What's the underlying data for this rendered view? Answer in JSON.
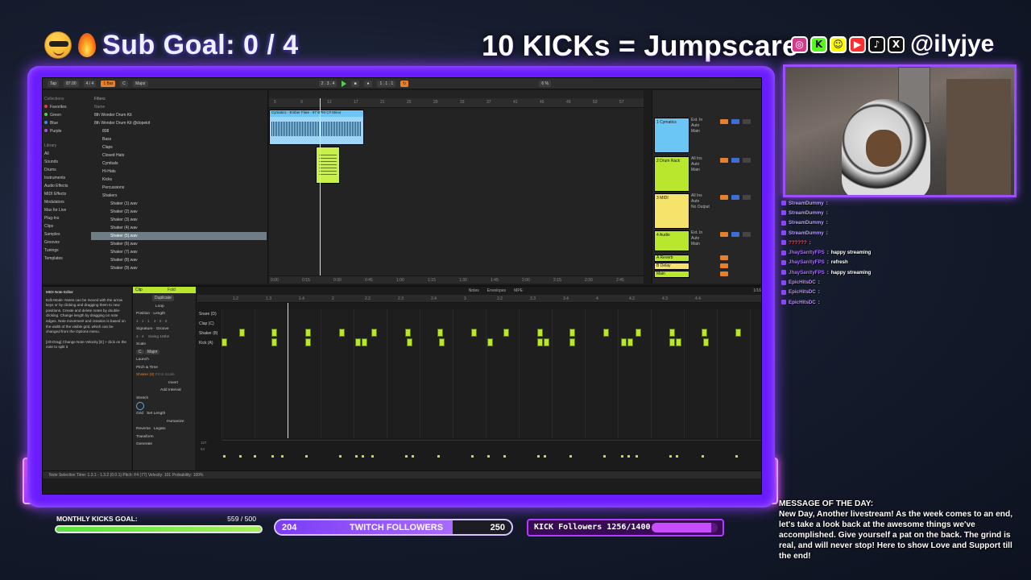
{
  "overlay": {
    "sub_goal": "Sub Goal: 0 / 4",
    "jumpscare": "10 KICKs = Jumpscare",
    "handle": "@ilyjye",
    "social_icons": [
      "instagram-icon",
      "kick-icon",
      "snapchat-icon",
      "youtube-icon",
      "tiktok-icon",
      "x-icon"
    ]
  },
  "daw": {
    "topbar": {
      "tempo": "Tap",
      "bpm": "87.00",
      "meter": "4 / 4",
      "quantize": "1 Bar",
      "key": "C",
      "scale": "Major",
      "position": "2 . 3 . 4",
      "loop": "1 . 1 . 1",
      "cpu": "6 %"
    },
    "browser": {
      "collections_header": "Collections",
      "collections": [
        "Favorites",
        "Green",
        "Blue",
        "Purple"
      ],
      "library_header": "Library",
      "library": [
        "All",
        "Sounds",
        "Drums",
        "Instruments",
        "Audio Effects",
        "MIDI Effects",
        "Modulators",
        "Max for Live",
        "Plug-Ins",
        "Clips",
        "Samples",
        "Grooves",
        "Tunings",
        "Templates"
      ],
      "filter_label": "Filters",
      "name_header": "Name",
      "tree": [
        "8th Wonder Drum Kit",
        "8th Wonder Drum Kit @dopekit",
        "808",
        "Bass",
        "Claps",
        "Closed Hats",
        "Cymbals",
        "Hi-Hats",
        "Kicks",
        "Percussions",
        "Shakers",
        "Shaker (1).wav",
        "Shaker (2).wav",
        "Shaker (3).wav",
        "Shaker (4).wav",
        "Shaker (5).wav",
        "Shaker (6).wav",
        "Shaker (7).wav",
        "Shaker (8).wav",
        "Shaker (9).wav"
      ],
      "selected_index": 15
    },
    "arrangement": {
      "ruler": [
        "5",
        "9",
        "13",
        "17",
        "21",
        "25",
        "29",
        "33",
        "37",
        "41",
        "45",
        "49",
        "53",
        "57"
      ],
      "audio_clip_name": "Cymatics - Ember Flute - 87 BPM C# Minor",
      "time_ruler": [
        "0:00",
        "0:15",
        "0:30",
        "0:45",
        "1:00",
        "1:15",
        "1:30",
        "1:45",
        "2:00",
        "2:15",
        "2:30",
        "2:45"
      ]
    },
    "mixer": {
      "tracks": [
        {
          "name": "1 Cymatics",
          "color": "#6cc6f5",
          "input": "Ext. In",
          "monitor": "Auto",
          "out": "Main"
        },
        {
          "name": "2 Drum Rack",
          "color": "#b8e72e",
          "input": "All Ins",
          "monitor": "Auto",
          "out": "Main"
        },
        {
          "name": "3 MIDI",
          "color": "#f5e36c",
          "input": "All Ins",
          "monitor": "Auto",
          "out": "No Output"
        },
        {
          "name": "4 Audio",
          "color": "#b8e72e",
          "input": "Ext. In",
          "monitor": "Auto",
          "out": "Main"
        }
      ],
      "returns": [
        "A Reverb",
        "B Delay",
        "Main"
      ],
      "return_colors": [
        "#b8e72e",
        "#f5e36c",
        "#b8e72e"
      ]
    },
    "info_panel": {
      "title": "MIDI Note Editor",
      "body": "Edit Mode: Notes can be moved with the arrow keys or by clicking and dragging them to new positions. Create and delete notes by double-clicking. Change length by dragging on note edges. Note movement and creation is based on the width of the visible grid, which can be changed from the Options menu.",
      "footer": "[Alt-Drag] Change Note Velocity [E] + click on the note to split it"
    },
    "clip_panel": {
      "clip_label": "Clip",
      "fold": "Fold",
      "duplicate": "Duplicate",
      "loop": "Loop",
      "position": "Position",
      "length": "Length",
      "signature": "Signature",
      "groove": "Groove",
      "scale_label": "Scale",
      "scale_key": "C",
      "scale_mode": "Major",
      "launch": "Launch",
      "pitch_time": "Pitch & Time",
      "shaker_label": "Shaker (8)",
      "fit_to_scale": "Fit to Scale",
      "invert": "Invert",
      "add_interval": "Add Interval",
      "stretch": "Stretch",
      "grid": "Grid",
      "set_length": "Set Length",
      "humanize": "Humanize",
      "reverse": "Reverse",
      "legato": "Legato",
      "transform": "Transform",
      "generate": "Generate"
    },
    "note_editor": {
      "tabs": [
        "Notes",
        "Envelopes",
        "MPE"
      ],
      "ruler": [
        "1.2",
        "1.3",
        "1.4",
        "2",
        "2.2",
        "2.3",
        "2.4",
        "3",
        "3.2",
        "3.3",
        "3.4",
        "4",
        "4.2",
        "4.3",
        "4.4"
      ],
      "grid_size": "1/16",
      "lanes": [
        "Snare (D)",
        "Clap (C)",
        "Shaker (8)",
        "Kick (A)"
      ],
      "velocity_top": "127",
      "velocity_mid": "64"
    },
    "status_bar": "Note Selection   Time: 1.3.1 - 1.3.2 (0.0.1)   Pitch: F4 (77)   Velocity: 101   Probability: 100%"
  },
  "chat": [
    {
      "user": "StreamDummy",
      "msg": "",
      "color": "#b7a2ff"
    },
    {
      "user": "StreamDummy",
      "msg": "",
      "color": "#b7a2ff"
    },
    {
      "user": "StreamDummy",
      "msg": "",
      "color": "#b7a2ff"
    },
    {
      "user": "StreamDummy",
      "msg": "",
      "color": "#b7a2ff"
    },
    {
      "user": "??????",
      "msg": "",
      "color": "#ff4a4a"
    },
    {
      "user": "JhaySanityFPS",
      "msg": "happy streaming",
      "color": "#a96bff"
    },
    {
      "user": "JhaySanityFPS",
      "msg": "refresh",
      "color": "#a96bff"
    },
    {
      "user": "JhaySanityFPS",
      "msg": "happy streaming",
      "color": "#a96bff"
    },
    {
      "user": "EpicHitsDC",
      "msg": "",
      "color": "#c08bff"
    },
    {
      "user": "EpicHitsDC",
      "msg": "",
      "color": "#c08bff"
    },
    {
      "user": "EpicHitsDC",
      "msg": "",
      "color": "#c08bff"
    }
  ],
  "motd": {
    "title": "MESSAGE OF THE DAY:",
    "body": "New Day, Another livestream! As the week comes to an end, let's take a look back at the awesome things we've accomplished. Give yourself a pat on the back. The grind is real, and will never stop! Here to show Love and Support till the end!"
  },
  "bottom": {
    "kicks_goal_label": "MONTHLY KICKS GOAL:",
    "kicks_goal_count": "559 / 500",
    "kicks_goal_progress": 1.0,
    "twitch_start": "204",
    "twitch_label": "TWITCH FOLLOWERS",
    "twitch_end": "250",
    "twitch_progress": 0.75,
    "kick_label": "KICK Followers 1256/1400",
    "kick_progress": 0.9
  }
}
